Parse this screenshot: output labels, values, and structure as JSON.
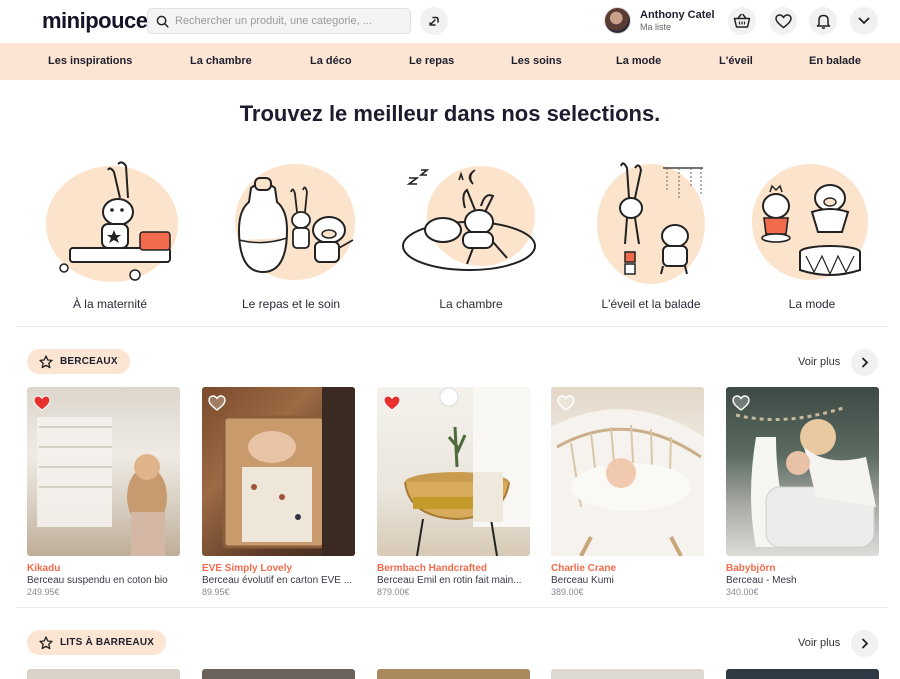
{
  "header": {
    "logo": "minipouce",
    "search_placeholder": "Rechercher un produit, une categorie, ...",
    "user_name": "Anthony Catel",
    "user_sub": "Ma liste"
  },
  "nav": [
    "Les inspirations",
    "La chambre",
    "La déco",
    "Le repas",
    "Les soins",
    "La mode",
    "L'éveil",
    "En balade"
  ],
  "main_title": "Trouvez le meilleur dans nos selections.",
  "categories": [
    "À la maternité",
    "Le repas et le soin",
    "La chambre",
    "L'éveil et la balade",
    "La mode"
  ],
  "sections": [
    {
      "title": "BERCEAUX",
      "more": "Voir plus"
    },
    {
      "title": "LITS À BARREAUX",
      "more": "Voir plus"
    }
  ],
  "products": [
    {
      "brand": "Kikadu",
      "name": "Berceau suspendu en coton bio",
      "price": "249.95€",
      "favorite": true
    },
    {
      "brand": "EVE Simply Lovely",
      "name": "Berceau évolutif en carton EVE ...",
      "price": "89.95€",
      "favorite": false
    },
    {
      "brand": "Bermbach Handcrafted",
      "name": "Berceau Emil en rotin fait main...",
      "price": "879.00€",
      "favorite": true
    },
    {
      "brand": "Charlie Crane",
      "name": "Berceau Kumi",
      "price": "389.00€",
      "favorite": false
    },
    {
      "brand": "Babybjörn",
      "name": "Berceau - Mesh",
      "price": "340.00€",
      "favorite": false
    }
  ],
  "colors": {
    "accent": "#f26b4c",
    "nav_bg": "#fce6d3",
    "heart_red": "#e8312f"
  }
}
